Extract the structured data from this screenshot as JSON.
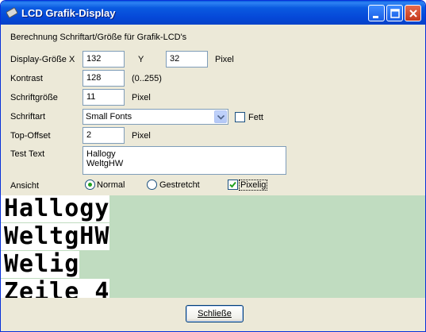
{
  "window": {
    "title": "LCD Grafik-Display"
  },
  "heading": "Berechnung Schriftart/Größe für Grafik-LCD's",
  "display_size": {
    "label": "Display-Größe X",
    "x_value": "132",
    "y_label": "Y",
    "y_value": "32",
    "unit": "Pixel"
  },
  "contrast": {
    "label": "Kontrast",
    "value": "128",
    "range_hint": "(0..255)"
  },
  "font_size": {
    "label": "Schriftgröße",
    "value": "11",
    "unit": "Pixel"
  },
  "font": {
    "label": "Schriftart",
    "selected": "Small Fonts",
    "bold_label": "Fett",
    "bold_checked": false
  },
  "top_offset": {
    "label": "Top-Offset",
    "value": "2",
    "unit": "Pixel"
  },
  "test_text": {
    "label": "Test Text",
    "line1": "Hallogy",
    "line2": "WeltgHW"
  },
  "view": {
    "label": "Ansicht",
    "option_normal": "Normal",
    "option_stretched": "Gestretcht",
    "option_pixel": "Pixelig",
    "selected": "Normal",
    "pixel_checked": true
  },
  "preview": {
    "lines": [
      "Hallogy",
      "WeltgHW",
      "Welig",
      "Zeile 4"
    ]
  },
  "footer": {
    "close_label": "Schließe"
  }
}
